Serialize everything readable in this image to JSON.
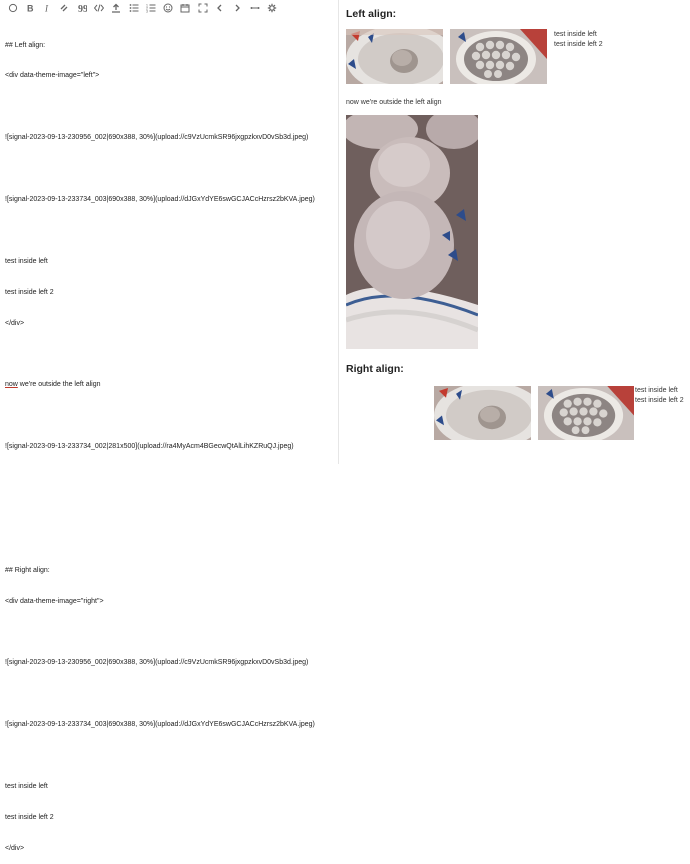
{
  "toolbar": {
    "buttons": [
      {
        "icon": "emoji-icon"
      },
      {
        "icon": "bold-icon"
      },
      {
        "icon": "italic-icon"
      },
      {
        "icon": "link-icon"
      },
      {
        "icon": "quote-icon"
      },
      {
        "icon": "code-icon"
      },
      {
        "icon": "upload-icon"
      },
      {
        "icon": "bullet-list-icon"
      },
      {
        "icon": "numbered-list-icon"
      },
      {
        "icon": "smiley-icon"
      },
      {
        "icon": "calendar-icon"
      },
      {
        "icon": "fullscreen-icon"
      },
      {
        "icon": "chevron-left-icon"
      },
      {
        "icon": "chevron-right-icon"
      },
      {
        "icon": "horizontal-rule-icon"
      },
      {
        "icon": "gear-icon"
      }
    ]
  },
  "editor": {
    "l1": "## Left align:",
    "l2": "<div data-theme-image=\"left\">",
    "l3": "![signal-2023-09-13-230956_002|690x388, 30%](upload://c9VzUcmkSR96jxgpzkxvD0vSb3d.jpeg)",
    "l4": "![signal-2023-09-13-233734_003|690x388, 30%](upload://dJGxYdYE6swGCJACcHzrsz2bKVA.jpeg)",
    "l5": "test inside left",
    "l6": "test inside left 2",
    "l7": "</div>",
    "l8a": "now",
    "l8b": " we're outside the left align",
    "l9": "![signal-2023-09-13-233734_002|281x500](upload://ra4MyAcm4BGecwQtAlLihKZRuQJ.jpeg)",
    "l10": "## Right align:",
    "l11": "<div data-theme-image=\"right\">",
    "l12": "![signal-2023-09-13-230956_002|690x388, 30%](upload://c9VzUcmkSR96jxgpzkxvD0vSb3d.jpeg)",
    "l13": "![signal-2023-09-13-233734_003|690x388, 30%](upload://dJGxYdYE6swGCJACcHzrsz2bKVA.jpeg)",
    "l14": "test inside left",
    "l15": "test inside left 2",
    "l16": "</div>"
  },
  "preview": {
    "left_heading": "Left align:",
    "left_text1": "test inside left",
    "left_text2": "test inside left 2",
    "outside_text": "now we're outside the left align",
    "right_heading": "Right align:",
    "right_text1": "test inside left",
    "right_text2": "test inside left 2"
  }
}
